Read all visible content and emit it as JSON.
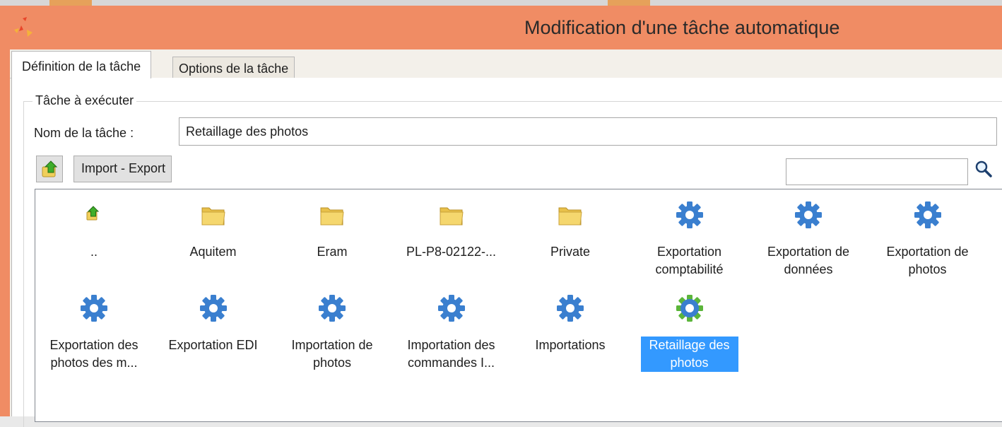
{
  "window": {
    "title": "Modification d'une tâche automatique"
  },
  "tabs": [
    {
      "label": "Définition de la tâche",
      "active": true
    },
    {
      "label": "Options de la tâche",
      "active": false
    }
  ],
  "group": {
    "label": "Tâche à exécuter"
  },
  "task_name": {
    "label": "Nom de la tâche :",
    "value": "Retaillage des photos"
  },
  "toolbar": {
    "crumb_label": "Import - Export",
    "search_value": ""
  },
  "items": [
    {
      "label": "..",
      "icon": "up-folder-icon"
    },
    {
      "label": "Aquitem",
      "icon": "folder-icon"
    },
    {
      "label": "Eram",
      "icon": "folder-icon"
    },
    {
      "label": "PL-P8-02122-...",
      "icon": "folder-icon"
    },
    {
      "label": "Private",
      "icon": "folder-icon"
    },
    {
      "label": "Exportation comptabilité",
      "icon": "gear-icon"
    },
    {
      "label": "Exportation de données",
      "icon": "gear-icon"
    },
    {
      "label": "Exportation de photos",
      "icon": "gear-icon"
    },
    {
      "label": "Exportation des photos des m...",
      "icon": "gear-icon"
    },
    {
      "label": "Exportation EDI",
      "icon": "gear-icon"
    },
    {
      "label": "Importation de photos",
      "icon": "gear-icon"
    },
    {
      "label": "Importation des commandes I...",
      "icon": "gear-icon"
    },
    {
      "label": "Importations",
      "icon": "gear-icon"
    },
    {
      "label": "Retaillage des photos",
      "icon": "gear-green-icon",
      "selected": true
    }
  ],
  "colors": {
    "title_bar": "#f08c64",
    "selection": "#3399ff",
    "gear": "#3a7fcf",
    "folder": "#f5d76e"
  }
}
